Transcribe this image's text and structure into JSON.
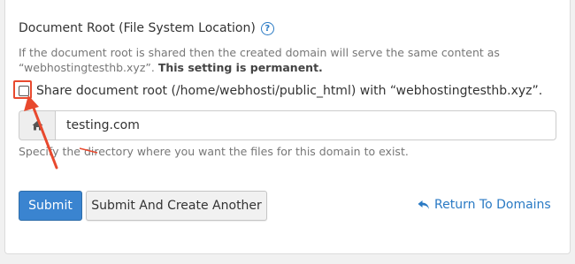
{
  "section": {
    "title": "Document Root (File System Location)",
    "help_icon": "question-circle-icon",
    "help_line1": "If the document root is shared then the created domain will serve the same content as",
    "help_line2_prefix": "“webhostingtesthb.xyz”. ",
    "help_line2_bold": "This setting is permanent."
  },
  "share_checkbox": {
    "checked": false,
    "label": "Share document root (/home/webhosti/public_html) with “webhostingtesthb.xyz”."
  },
  "document_root_input": {
    "addon_icon": "home-icon",
    "value": "testing.com"
  },
  "directory_help": "Specify the directory where you want the files for this domain to exist.",
  "actions": {
    "submit_label": "Submit",
    "submit_another_label": "Submit And Create Another",
    "return_label": "Return To Domains",
    "return_icon": "reply-icon"
  },
  "colors": {
    "primary": "#3a84d0",
    "link": "#2a7ac4",
    "annotation": "#e8492e"
  }
}
